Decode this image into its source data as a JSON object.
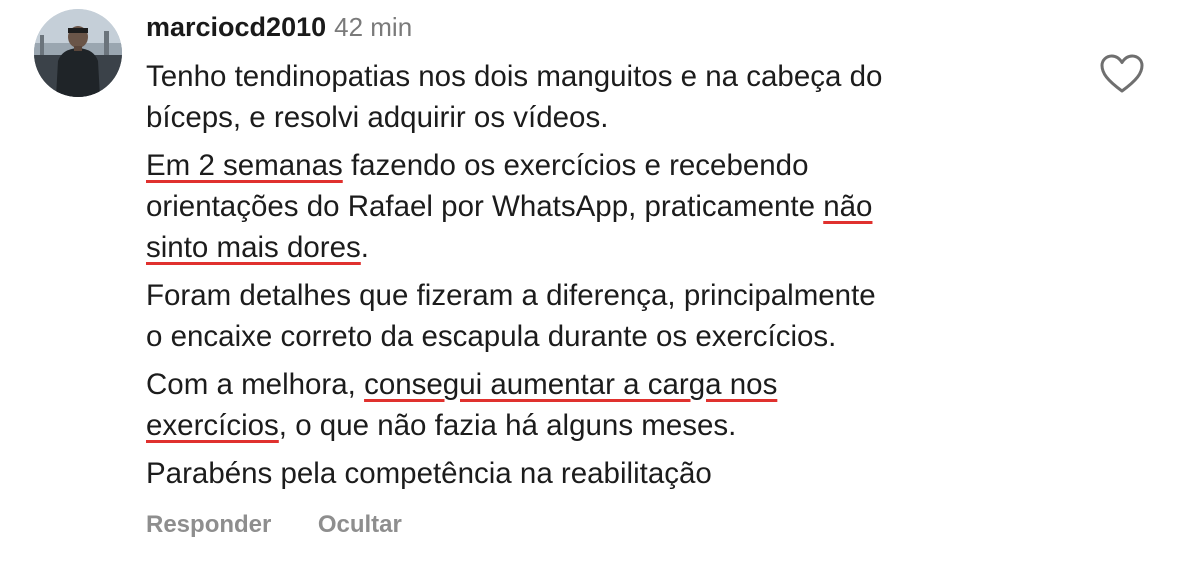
{
  "comment": {
    "username": "marciocd2010",
    "time": "42 min",
    "paragraphs": {
      "p1": {
        "l1": "Tenho tendinopatias nos dois manguitos e na cabeça do",
        "l2": "bíceps, e resolvi adquirir os vídeos."
      },
      "p2": {
        "u1": "Em 2 semanas",
        "t1": " fazendo os exercícios e recebendo",
        "t2": "orientações do Rafael por WhatsApp, praticamente ",
        "u2": "não",
        "u3": "sinto mais dores",
        "t3": "."
      },
      "p3": {
        "l1": "Foram detalhes que fizeram a diferença, principalmente",
        "l2": "o encaixe correto da escapula durante os exercícios."
      },
      "p4": {
        "t1": "Com a melhora, ",
        "u1": "consegui aumentar a carga nos",
        "u2": "exercícios",
        "t2": ", o que não fazia há alguns meses."
      },
      "p5": {
        "l1": "Parabéns pela competência na reabilitação"
      }
    }
  },
  "actions": {
    "reply": "Responder",
    "hide": "Ocultar"
  },
  "icons": {
    "like": "heart-outline-icon",
    "avatar": "user-avatar-photo"
  },
  "colors": {
    "underline": "#e0312e",
    "muted": "#8e8e8e",
    "time": "#7a7a7a",
    "text": "#1c1c1c"
  }
}
